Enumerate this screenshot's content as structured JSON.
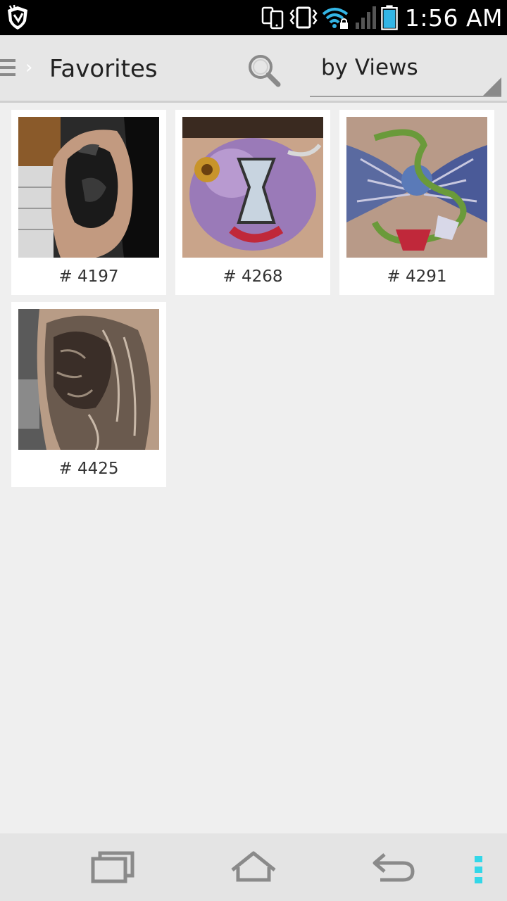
{
  "status_bar": {
    "time": "1:56 AM",
    "icons": [
      "shield-app-icon",
      "phone-sync-icon",
      "vibrate-icon",
      "wifi-locked-icon",
      "signal-icon",
      "battery-icon"
    ]
  },
  "action_bar": {
    "title": "Favorites",
    "sort_value": "by Views",
    "icons": [
      "menu-icon",
      "chevron-right-icon",
      "search-icon",
      "dropdown-triangle-icon"
    ]
  },
  "favorites": [
    {
      "label": "# 4197",
      "image": "raven-sleeve-tattoo"
    },
    {
      "label": "# 4268",
      "image": "color-hourglass-tattoo"
    },
    {
      "label": "# 4291",
      "image": "winged-snake-tattoo"
    },
    {
      "label": "# 4425",
      "image": "lion-sleeve-tattoo"
    }
  ],
  "nav_bar": {
    "icons": [
      "recent-apps-icon",
      "home-icon",
      "back-icon",
      "overflow-menu-icon"
    ]
  },
  "colors": {
    "status_bar_bg": "#000000",
    "action_bar_bg": "#e6e6e6",
    "background": "#efefef",
    "overflow_accent": "#33d7e8",
    "wifi_accent": "#33b5e5",
    "battery_accent": "#33b5e5"
  }
}
